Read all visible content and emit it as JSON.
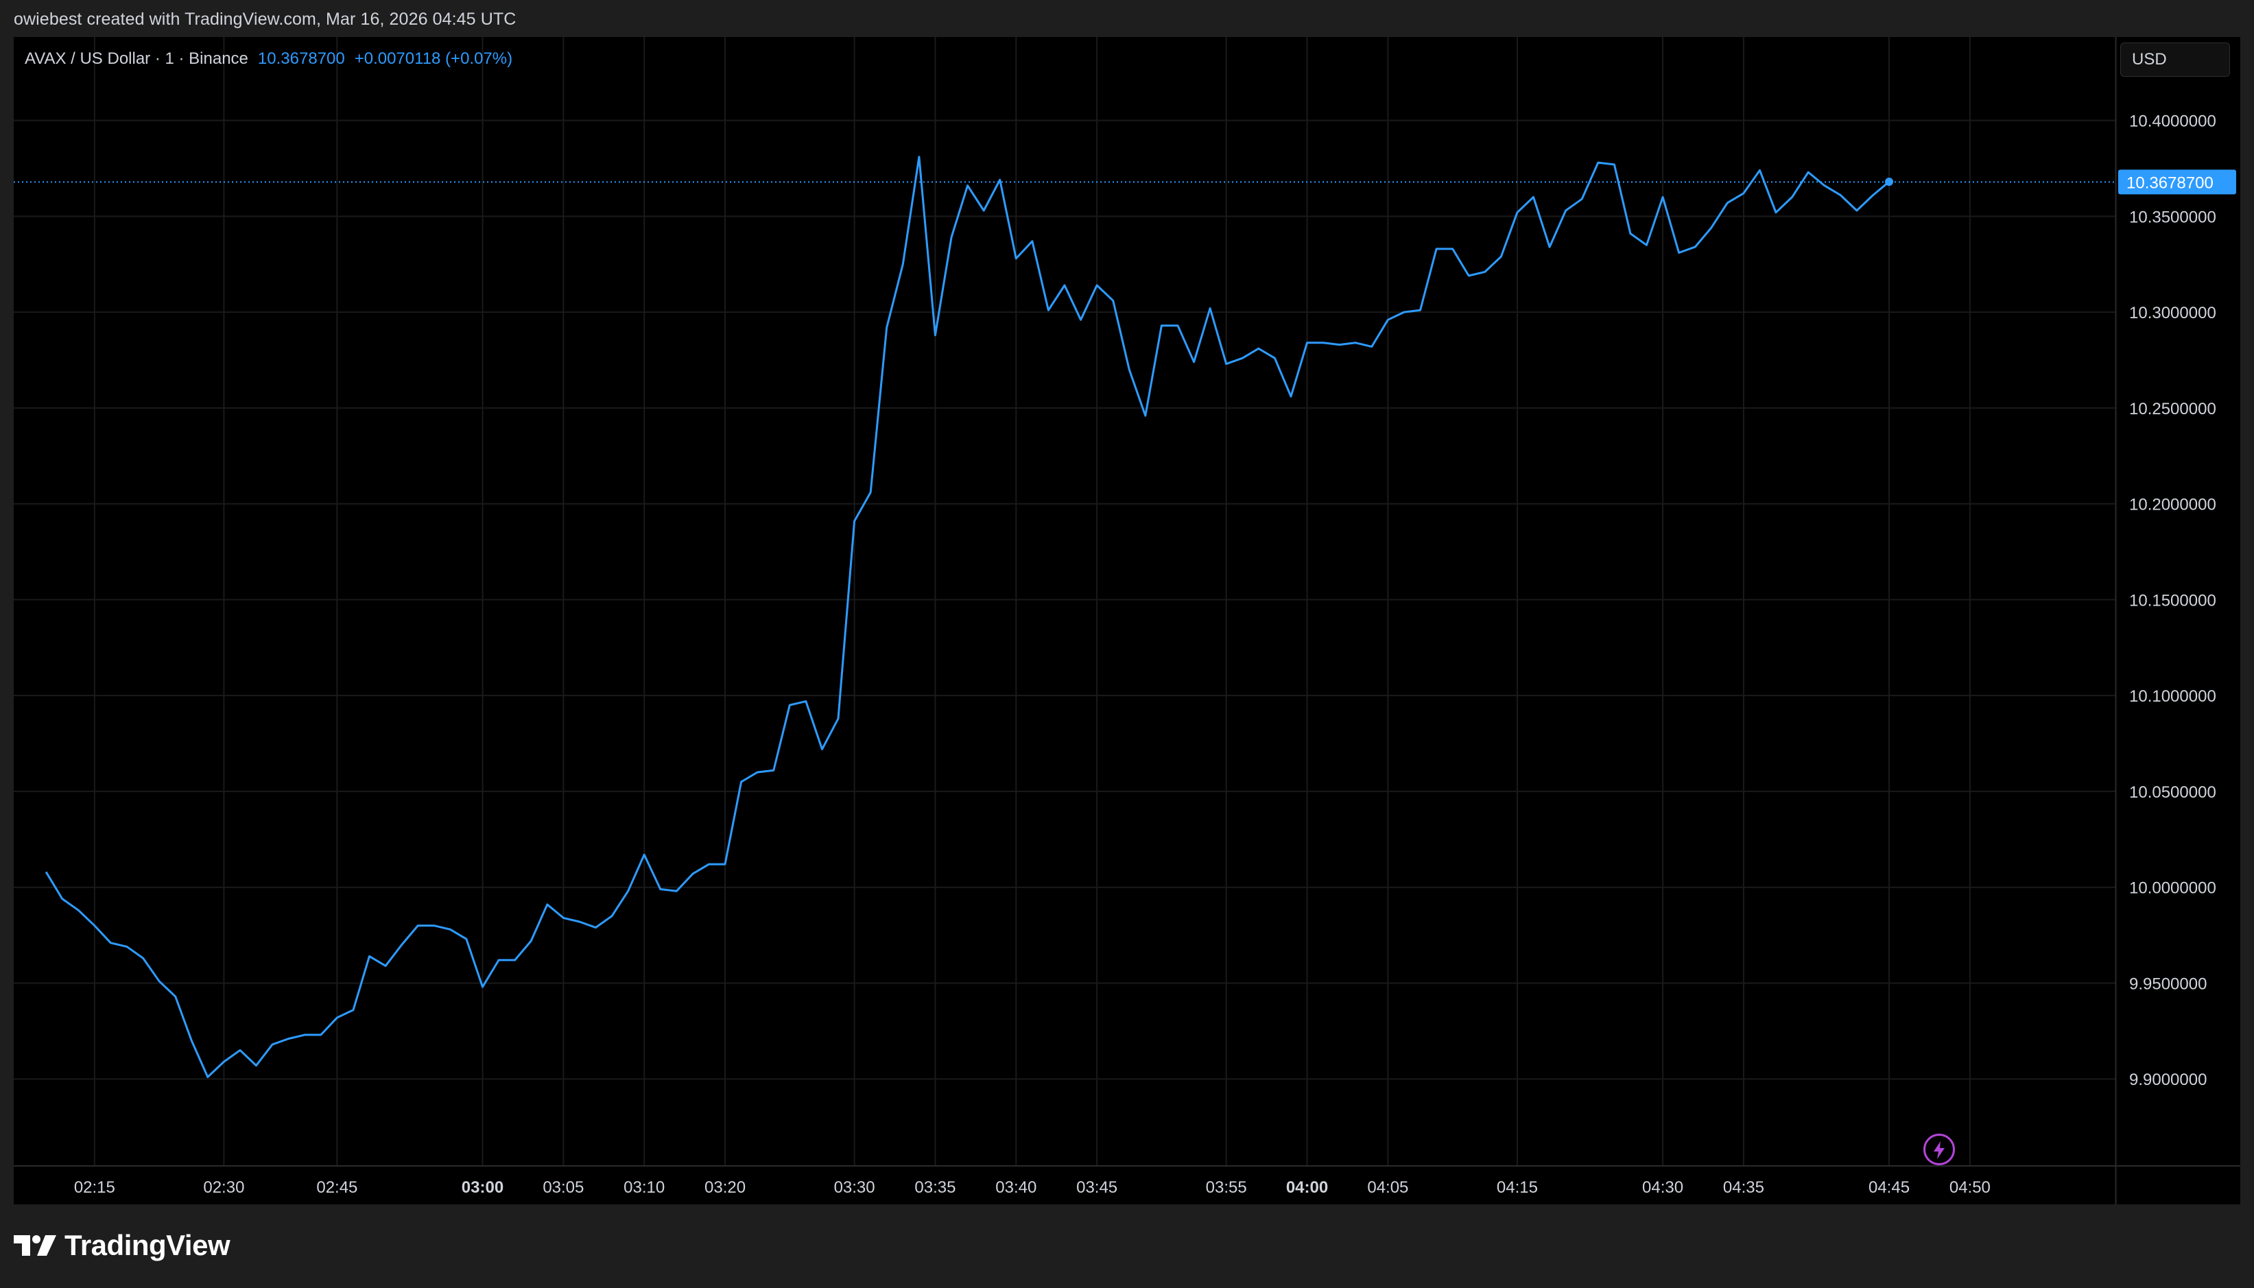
{
  "header": {
    "attribution": "owiebest created with TradingView.com, Mar 16, 2026 04:45 UTC"
  },
  "legend": {
    "symbol": "AVAX / US Dollar · 1 · Binance",
    "last": "10.3678700",
    "change": "+0.0070118 (+0.07%)"
  },
  "currency": {
    "label": "USD"
  },
  "colors": {
    "line": "#2e9bff",
    "price_label_bg": "#2e9bff",
    "background": "#000000",
    "grid": "#1a1a1a",
    "axis_text": "#d1d4dc",
    "bolt": "#b345d8"
  },
  "icons": {
    "bolt": "lightning-bolt-icon",
    "logo": "tradingview-logo-icon"
  },
  "brand": {
    "wordmark": "TradingView"
  },
  "chart_data": {
    "type": "line",
    "title": "AVAX / US Dollar · 1 · Binance",
    "xlabel": "",
    "ylabel": "",
    "ylim": [
      9.855,
      10.4435
    ],
    "xlim": [
      -2,
      128
    ],
    "grid": true,
    "last_price": 10.36787,
    "last_price_label": "10.3678700",
    "y_ticks": [
      {
        "value": 10.4,
        "label": "10.4000000"
      },
      {
        "value": 10.35,
        "label": "10.3500000"
      },
      {
        "value": 10.3,
        "label": "10.3000000"
      },
      {
        "value": 10.25,
        "label": "10.2500000"
      },
      {
        "value": 10.2,
        "label": "10.2000000"
      },
      {
        "value": 10.15,
        "label": "10.1500000"
      },
      {
        "value": 10.1,
        "label": "10.1000000"
      },
      {
        "value": 10.05,
        "label": "10.0500000"
      },
      {
        "value": 10.0,
        "label": "10.0000000"
      },
      {
        "value": 9.95,
        "label": "9.9500000"
      },
      {
        "value": 9.9,
        "label": "9.9000000"
      }
    ],
    "x_ticks": [
      {
        "minute": 3,
        "label": "02:15",
        "bold": false
      },
      {
        "minute": 11,
        "label": "02:30",
        "bold": false
      },
      {
        "minute": 18,
        "label": "02:45",
        "bold": false
      },
      {
        "minute": 27,
        "label": "03:00",
        "bold": true
      },
      {
        "minute": 32,
        "label": "03:05",
        "bold": false
      },
      {
        "minute": 37,
        "label": "03:10",
        "bold": false
      },
      {
        "minute": 42,
        "label": "03:20",
        "bold": false
      },
      {
        "minute": 50,
        "label": "03:30",
        "bold": false
      },
      {
        "minute": 55,
        "label": "03:35",
        "bold": false
      },
      {
        "minute": 60,
        "label": "03:40",
        "bold": false
      },
      {
        "minute": 65,
        "label": "03:45",
        "bold": false
      },
      {
        "minute": 73,
        "label": "03:55",
        "bold": false
      },
      {
        "minute": 78,
        "label": "04:00",
        "bold": true
      },
      {
        "minute": 83,
        "label": "04:05",
        "bold": false
      },
      {
        "minute": 91,
        "label": "04:15",
        "bold": false
      },
      {
        "minute": 100,
        "label": "04:30",
        "bold": false
      },
      {
        "minute": 105,
        "label": "04:35",
        "bold": false
      },
      {
        "minute": 114,
        "label": "04:45",
        "bold": false
      },
      {
        "minute": 119,
        "label": "04:50",
        "bold": false
      }
    ],
    "series": [
      {
        "x": [
          0,
          1,
          2,
          3,
          4,
          5,
          6,
          7,
          8,
          9,
          10,
          11,
          12,
          13,
          14,
          15,
          16,
          17,
          18,
          19,
          20,
          21,
          22,
          23,
          24,
          25,
          26,
          27,
          28,
          29,
          30,
          31,
          32,
          33,
          34,
          35,
          36,
          37,
          38,
          39,
          40,
          41,
          42,
          43,
          44,
          45,
          46,
          47,
          48,
          49,
          50,
          51,
          52,
          53,
          54,
          55,
          56,
          57,
          58,
          59,
          60,
          61,
          62,
          63,
          64,
          65,
          66,
          67,
          68,
          69,
          70,
          71,
          72,
          73,
          74,
          75,
          76,
          77,
          78,
          79,
          80,
          81,
          82,
          83,
          84,
          85,
          86,
          87,
          88,
          89,
          90,
          91,
          92,
          93,
          94,
          95,
          96,
          97,
          98,
          99,
          100,
          101,
          102,
          103,
          104,
          105,
          106,
          107,
          108,
          109,
          110,
          111,
          112,
          113,
          114
        ],
        "values": [
          10.008,
          9.994,
          9.988,
          9.98,
          9.971,
          9.969,
          9.963,
          9.951,
          9.943,
          9.92,
          9.901,
          9.909,
          9.915,
          9.907,
          9.918,
          9.921,
          9.923,
          9.923,
          9.932,
          9.936,
          9.964,
          9.959,
          9.97,
          9.98,
          9.98,
          9.978,
          9.973,
          9.948,
          9.962,
          9.962,
          9.972,
          9.991,
          9.984,
          9.982,
          9.979,
          9.985,
          9.998,
          10.017,
          9.999,
          9.998,
          10.007,
          10.012,
          10.012,
          10.055,
          10.06,
          10.061,
          10.095,
          10.097,
          10.072,
          10.088,
          10.191,
          10.206,
          10.292,
          10.325,
          10.381,
          10.288,
          10.339,
          10.366,
          10.353,
          10.369,
          10.328,
          10.337,
          10.301,
          10.314,
          10.296,
          10.314,
          10.306,
          10.27,
          10.246,
          10.293,
          10.293,
          10.274,
          10.302,
          10.273,
          10.276,
          10.281,
          10.276,
          10.256,
          10.284,
          10.284,
          10.283,
          10.284,
          10.282,
          10.296,
          10.3,
          10.301,
          10.333,
          10.333,
          10.319,
          10.321,
          10.329,
          10.352,
          10.36,
          10.334,
          10.353,
          10.359,
          10.378,
          10.377,
          10.341,
          10.335,
          10.36,
          10.331,
          10.334,
          10.344,
          10.357,
          10.362,
          10.374,
          10.352,
          10.36,
          10.373,
          10.366,
          10.361,
          10.353,
          10.361,
          10.368
        ]
      }
    ]
  }
}
